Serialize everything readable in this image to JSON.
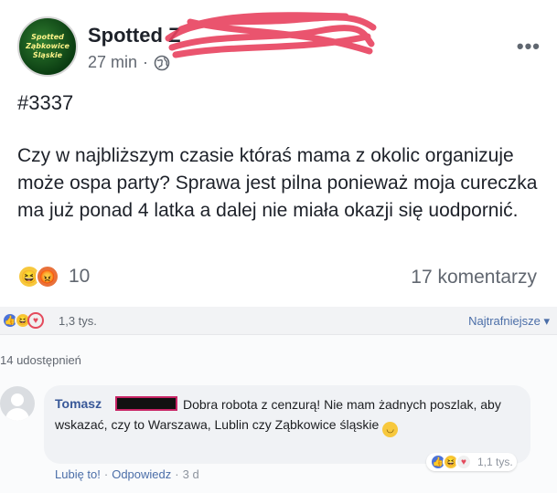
{
  "post": {
    "avatar_text": [
      "Spotted",
      "Ząbkowice",
      "Śląskie"
    ],
    "page_name": "Spotted Z",
    "time": "27 min",
    "meta_sep": "·",
    "more": "•••",
    "post_id": "#3337",
    "text": "Czy w najbliższym czasie któraś mama z okolic organizuje może ospa party? Sprawa jest pilna ponieważ moja cureczka ma już  ponad 4 latka a dalej nie miała okazji się uodpornić.",
    "reaction_count": "10",
    "comments_count": "17 komentarzy"
  },
  "stats": {
    "reaction_total": "1,3 tys.",
    "sort_label": "Najtrafniejsze ▾"
  },
  "shares": {
    "label": "14 udostępnień"
  },
  "comment": {
    "author": "Tomasz",
    "text": "Dobra robota z cenzurą! Nie mam żadnych poszlak, aby wskazać, czy to Warszawa, Lublin czy Ząbkowice śląskie",
    "reaction_total": "1,1 tys.",
    "like_label": "Lubię to!",
    "reply_label": "Odpowiedz",
    "sep": "·",
    "time": "3 d"
  },
  "colors": {
    "link": "#4b6ea8",
    "name": "#385898",
    "redact_stroke": "#e02a4c"
  },
  "icons": [
    "globe-icon",
    "haha-icon",
    "angry-icon",
    "like-icon",
    "love-icon",
    "smiley-icon",
    "more-icon",
    "avatar-icon"
  ]
}
